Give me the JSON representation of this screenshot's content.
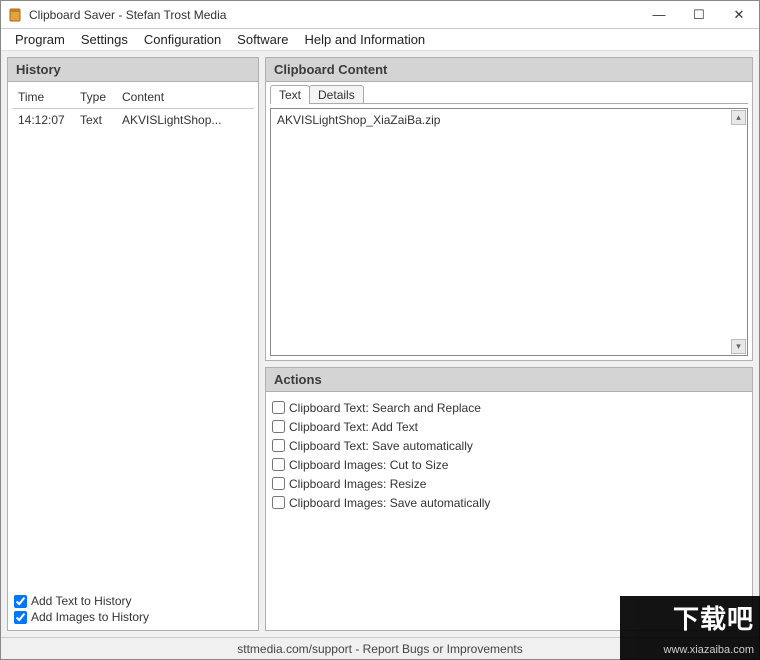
{
  "window": {
    "title": "Clipboard Saver - Stefan Trost Media"
  },
  "menu": {
    "program": "Program",
    "settings": "Settings",
    "configuration": "Configuration",
    "software": "Software",
    "help": "Help and Information"
  },
  "history": {
    "header": "History",
    "columns": {
      "time": "Time",
      "type": "Type",
      "content": "Content"
    },
    "rows": [
      {
        "time": "14:12:07",
        "type": "Text",
        "content": "AKVISLightShop..."
      }
    ],
    "add_text_label": "Add Text to History",
    "add_images_label": "Add Images to History"
  },
  "clipboard": {
    "header": "Clipboard Content",
    "tabs": {
      "text": "Text",
      "details": "Details"
    },
    "content_text": "AKVISLightShop_XiaZaiBa.zip"
  },
  "actions": {
    "header": "Actions",
    "items": [
      "Clipboard Text: Search and Replace",
      "Clipboard Text: Add Text",
      "Clipboard Text: Save automatically",
      "Clipboard Images: Cut to Size",
      "Clipboard Images: Resize",
      "Clipboard Images: Save automatically"
    ]
  },
  "statusbar": "sttmedia.com/support - Report Bugs or Improvements",
  "watermark": {
    "text": "下载吧",
    "url": "www.xiazaiba.com"
  }
}
